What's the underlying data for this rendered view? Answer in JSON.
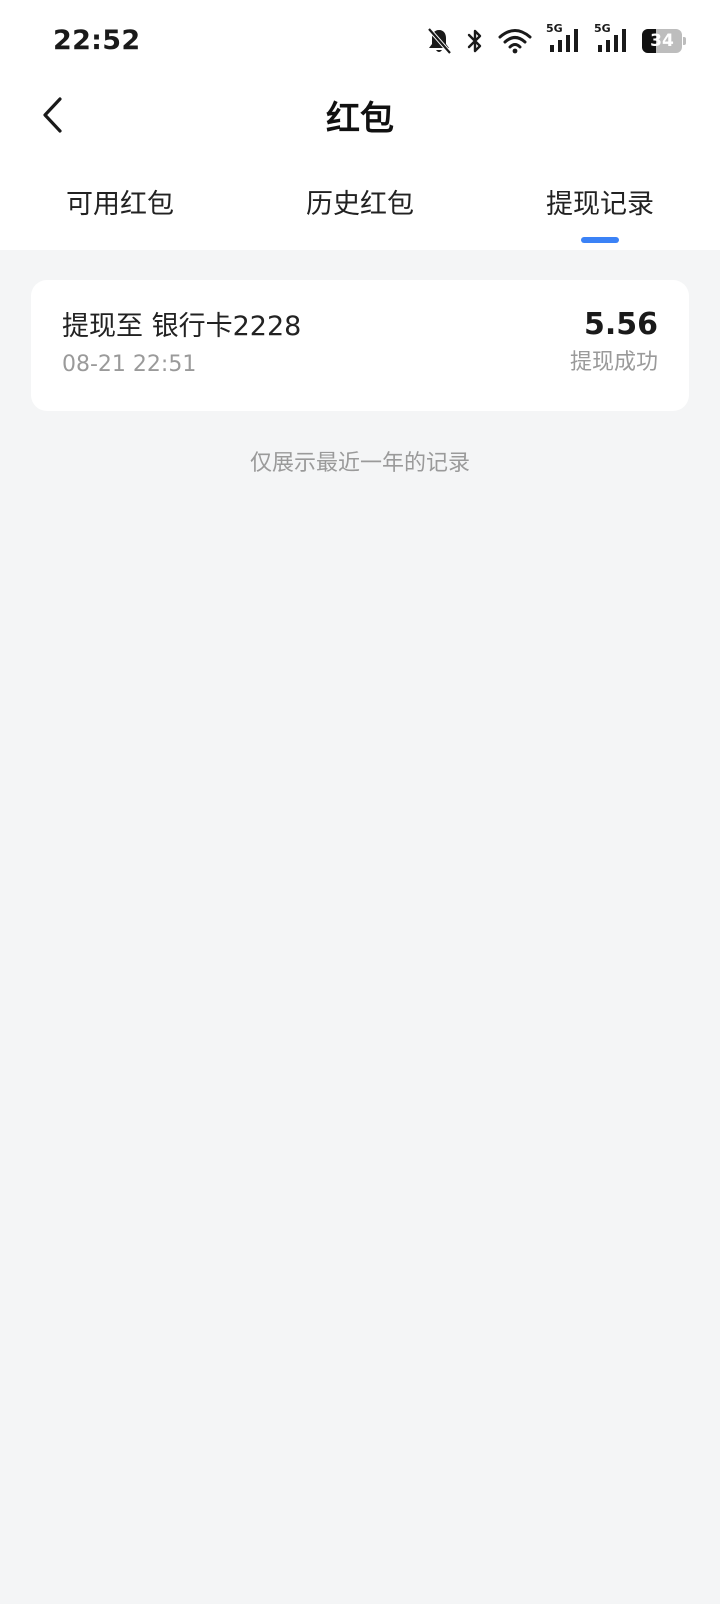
{
  "status_bar": {
    "time": "22:52",
    "icons": [
      "bell-muted-icon",
      "bluetooth-icon",
      "wifi-icon",
      "signal-5g-icon",
      "signal-5g-icon",
      "battery-icon"
    ],
    "signal_1_label": "5G",
    "signal_2_label": "5G",
    "battery_level": "34",
    "battery_fraction": 0.34
  },
  "header": {
    "back_icon": "chevron-left-icon",
    "title": "红包"
  },
  "tabs": [
    {
      "label": "可用红包",
      "active": false
    },
    {
      "label": "历史红包",
      "active": false
    },
    {
      "label": "提现记录",
      "active": true
    }
  ],
  "accent_color": "#3b82f6",
  "records": [
    {
      "title": "提现至 银行卡2228",
      "time": "08-21 22:51",
      "amount": "5.56",
      "status": "提现成功"
    }
  ],
  "footer_note": "仅展示最近一年的记录"
}
